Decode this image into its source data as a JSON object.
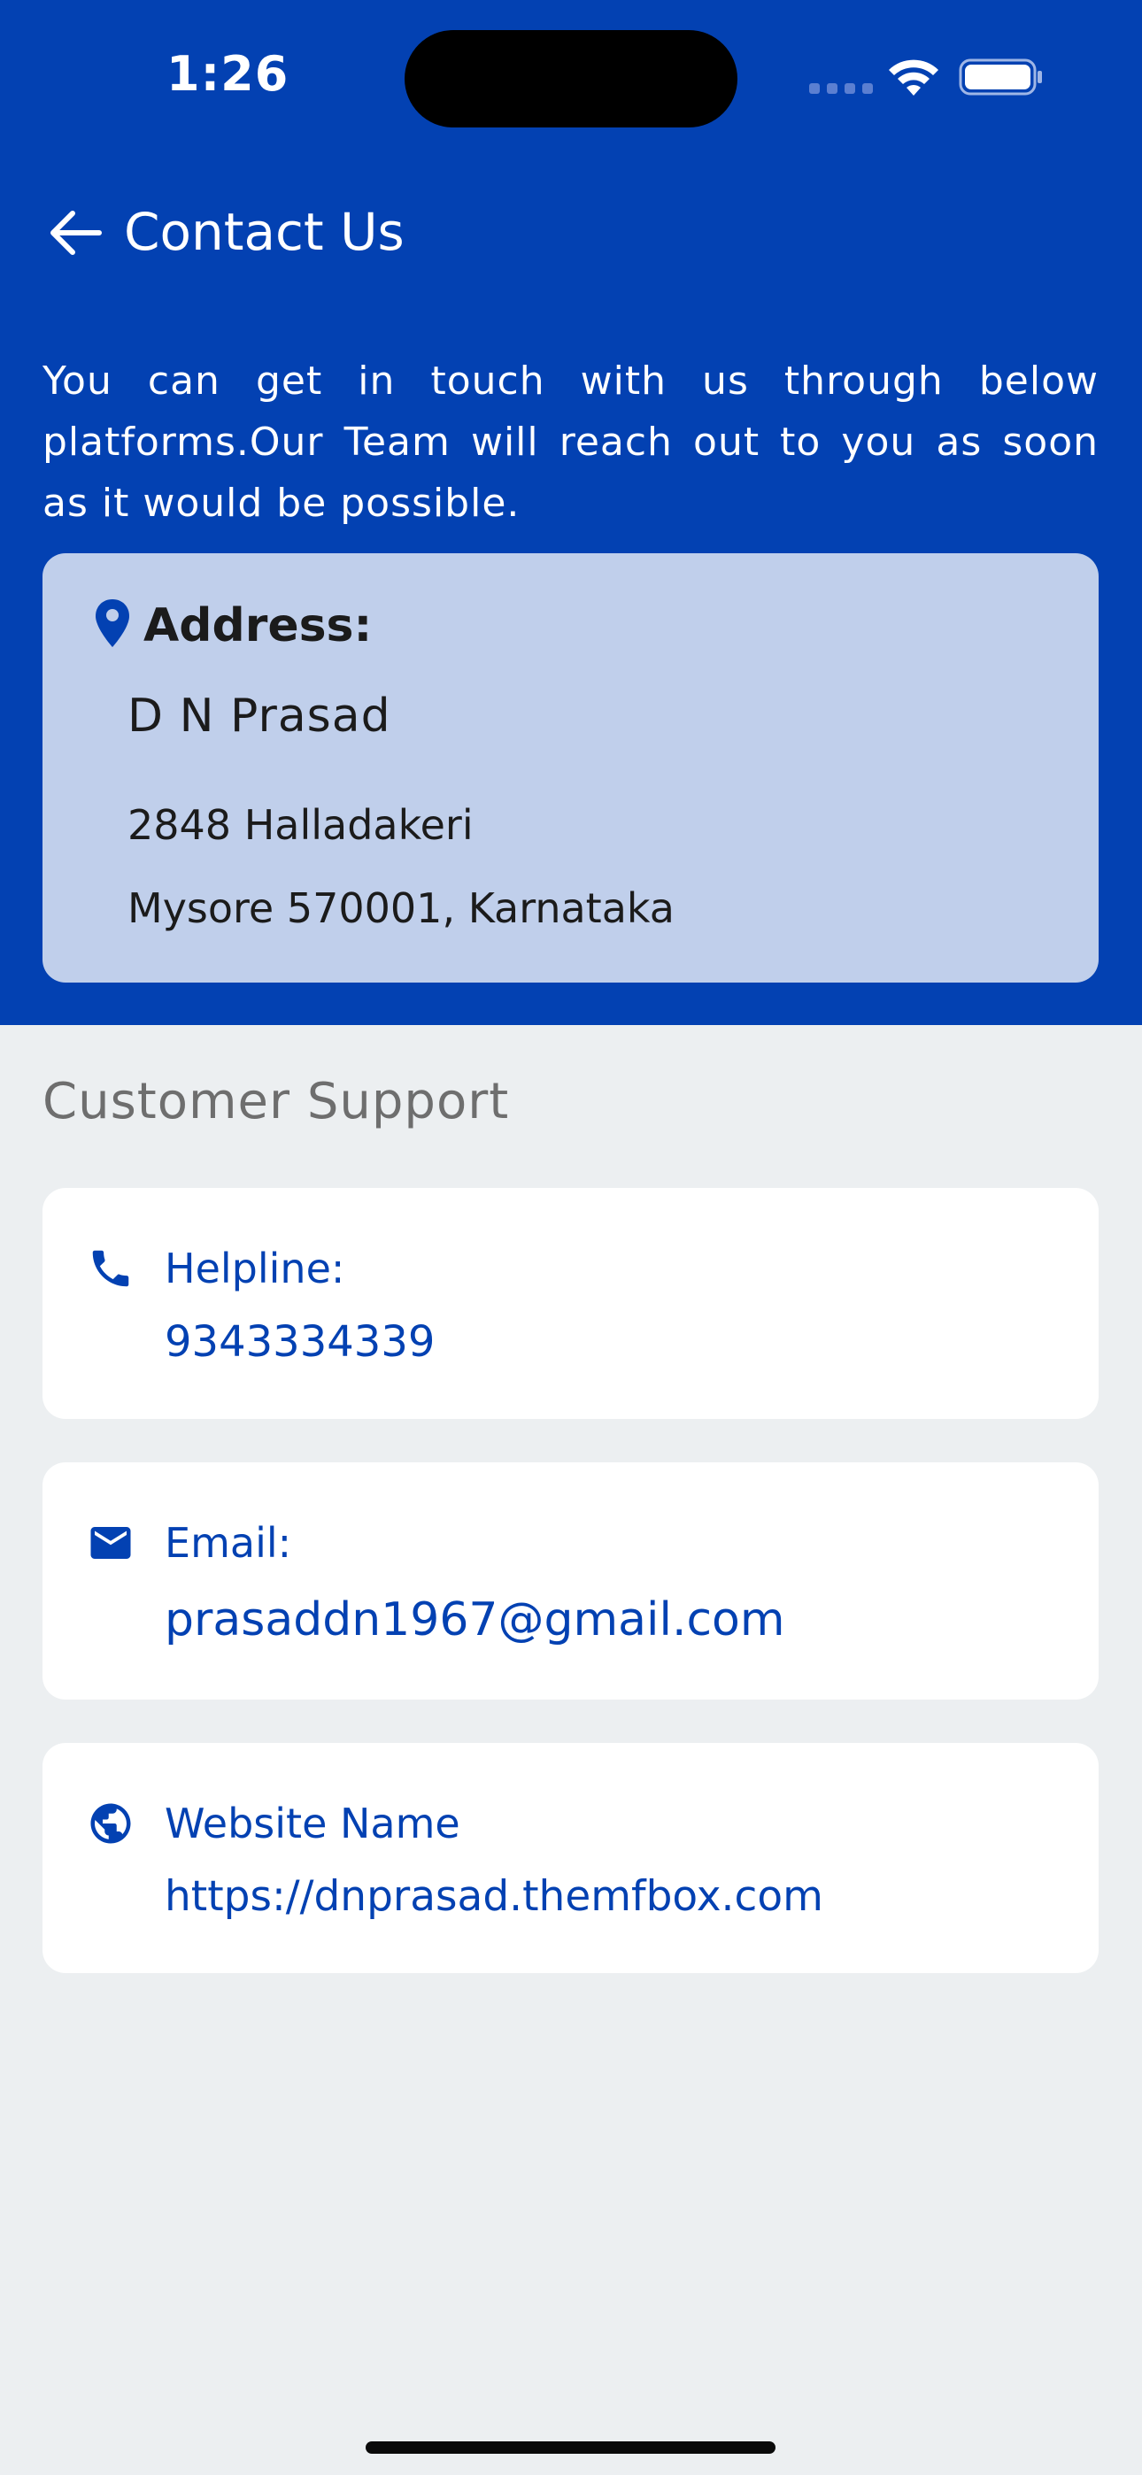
{
  "status_bar": {
    "time": "1:26"
  },
  "header": {
    "title": "Contact Us",
    "back_icon": "arrow-left-icon"
  },
  "intro": "You can get in touch with us through below platforms.Our Team will reach out to you as soon as it would be possible.",
  "address": {
    "icon": "map-pin-icon",
    "heading": "Address:",
    "name": "D N Prasad",
    "line1": "2848 Halladakeri",
    "line2": "Mysore 570001, Karnataka"
  },
  "support": {
    "title": "Customer Support",
    "helpline": {
      "icon": "phone-icon",
      "label": "Helpline:",
      "value": "9343334339"
    },
    "email": {
      "icon": "mail-icon",
      "label": "Email:",
      "value": "prasaddn1967@gmail.com"
    },
    "website": {
      "icon": "globe-icon",
      "label": "Website Name",
      "value": "https://dnprasad.themfbox.com"
    }
  },
  "colors": {
    "brand": "#0341b2",
    "address_card": "#c0cfeb",
    "background": "#eceff1"
  }
}
